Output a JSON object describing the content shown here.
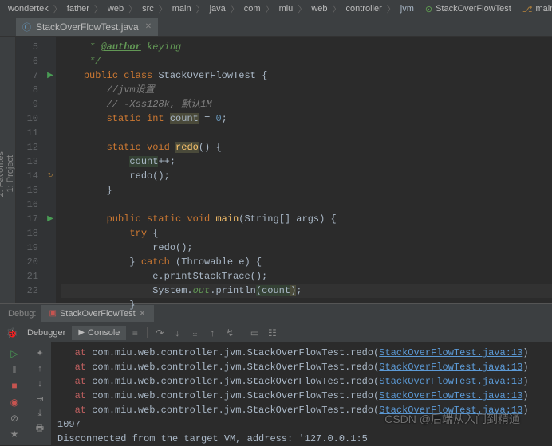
{
  "breadcrumb": {
    "items": [
      "wondertek",
      "father",
      "web",
      "src",
      "main",
      "java",
      "com",
      "miu",
      "web",
      "controller",
      "jvm"
    ],
    "test_label": "StackOverFlowTest",
    "branch_label": "main"
  },
  "tab": {
    "label": "StackOverFlowTest.java"
  },
  "gutter": {
    "lines": [
      "",
      "5",
      "6",
      "7",
      "8",
      "9",
      "10",
      "11",
      "12",
      "13",
      "14",
      "15",
      "16",
      "17",
      "18",
      "19",
      "20",
      "21",
      "22"
    ]
  },
  "code": {
    "author_tag": "@author",
    "author_name": "keying",
    "doc_close": "*/",
    "kw_public": "public",
    "kw_class": "class",
    "classname": "StackOverFlowTest",
    "comment1": "//jvm设置",
    "comment2": "// -Xss128k, 默认1M",
    "kw_static": "static",
    "kw_int": "int",
    "field_count": "count",
    "eq": "=",
    "zero": "0",
    "kw_void": "void",
    "m_redo": "redo",
    "count_inc": "count",
    "kw_main": "main",
    "main_args": "String[] args",
    "kw_try": "try",
    "kw_catch": "catch",
    "throwable": "Throwable e",
    "pst": "e.printStackTrace();",
    "sys": "System.",
    "out": "out",
    "println": "println",
    "arg_count": "count"
  },
  "debug": {
    "label": "Debug:",
    "config": "StackOverFlowTest",
    "debugger_tab": "Debugger",
    "console_tab": "Console",
    "output_count": "1097",
    "stack_prefix": "at ",
    "stack_pkg": "com.miu.web.controller.jvm.StackOverFlowTest.redo",
    "stack_link": "StackOverFlowTest.java:13",
    "disconnect": "Disconnected from the target VM, address: '127.0.0.1:5",
    "disconnect_tail": "'"
  },
  "watermark": "CSDN @后端从入门到精通"
}
